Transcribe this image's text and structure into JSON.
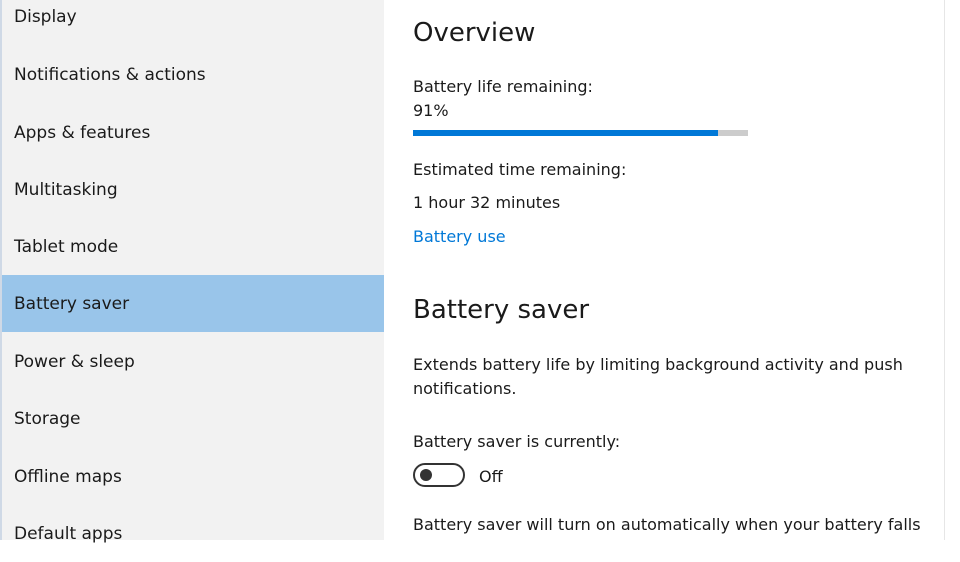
{
  "sidebar": {
    "items": [
      {
        "label": "Display"
      },
      {
        "label": "Notifications & actions"
      },
      {
        "label": "Apps & features"
      },
      {
        "label": "Multitasking"
      },
      {
        "label": "Tablet mode"
      },
      {
        "label": "Battery saver",
        "selected": true
      },
      {
        "label": "Power & sleep"
      },
      {
        "label": "Storage"
      },
      {
        "label": "Offline maps"
      },
      {
        "label": "Default apps"
      }
    ]
  },
  "overview": {
    "heading": "Overview",
    "battery_label": "Battery life remaining:",
    "battery_value": "91%",
    "battery_fraction": 0.91,
    "time_label": "Estimated time remaining:",
    "time_value": "1 hour 32 minutes",
    "battery_use_link": "Battery use"
  },
  "battery_saver": {
    "heading": "Battery saver",
    "description_line1": "Extends battery life by limiting background activity and push",
    "description_line2": "notifications.",
    "status_label": "Battery saver is currently:",
    "toggle_state": "Off",
    "auto_line": "Battery saver will turn on automatically when your battery falls"
  },
  "colors": {
    "accent": "#0078d7",
    "selected_nav": "#99c5ea",
    "sidebar_bg": "#f2f2f2"
  }
}
